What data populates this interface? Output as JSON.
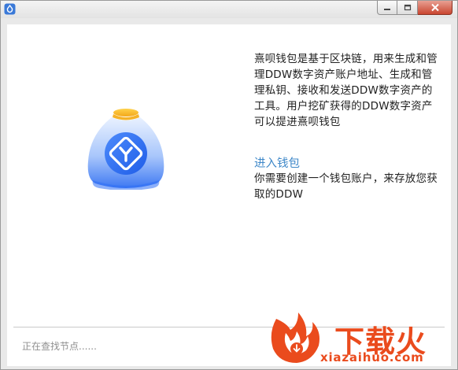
{
  "window": {
    "buttons": {
      "minimize": "minimize",
      "maximize": "maximize",
      "close": "close"
    }
  },
  "main": {
    "description": "熹呗钱包是基于区块链，用来生成和管理DDW数字资产账户地址、生成和管理私钥、接收和发送DDW数字资产的工具。用户挖矿获得的DDW数字资产可以提进熹呗钱包",
    "enter_wallet_link": "进入钱包",
    "enter_wallet_desc": "你需要创建一个钱包账户，来存放您获取的DDW"
  },
  "status": {
    "text": "正在查找节点......"
  },
  "watermark": {
    "name": "下载火",
    "domain": "xiazaihuo.com"
  },
  "colors": {
    "link": "#3d87c8",
    "logo_blue": "#2f6ff5",
    "watermark": "#ea4b1d"
  },
  "icons": [
    "app-icon",
    "minimize-icon",
    "maximize-icon",
    "close-icon",
    "wallet-logo-icon",
    "download-logo-icon"
  ]
}
